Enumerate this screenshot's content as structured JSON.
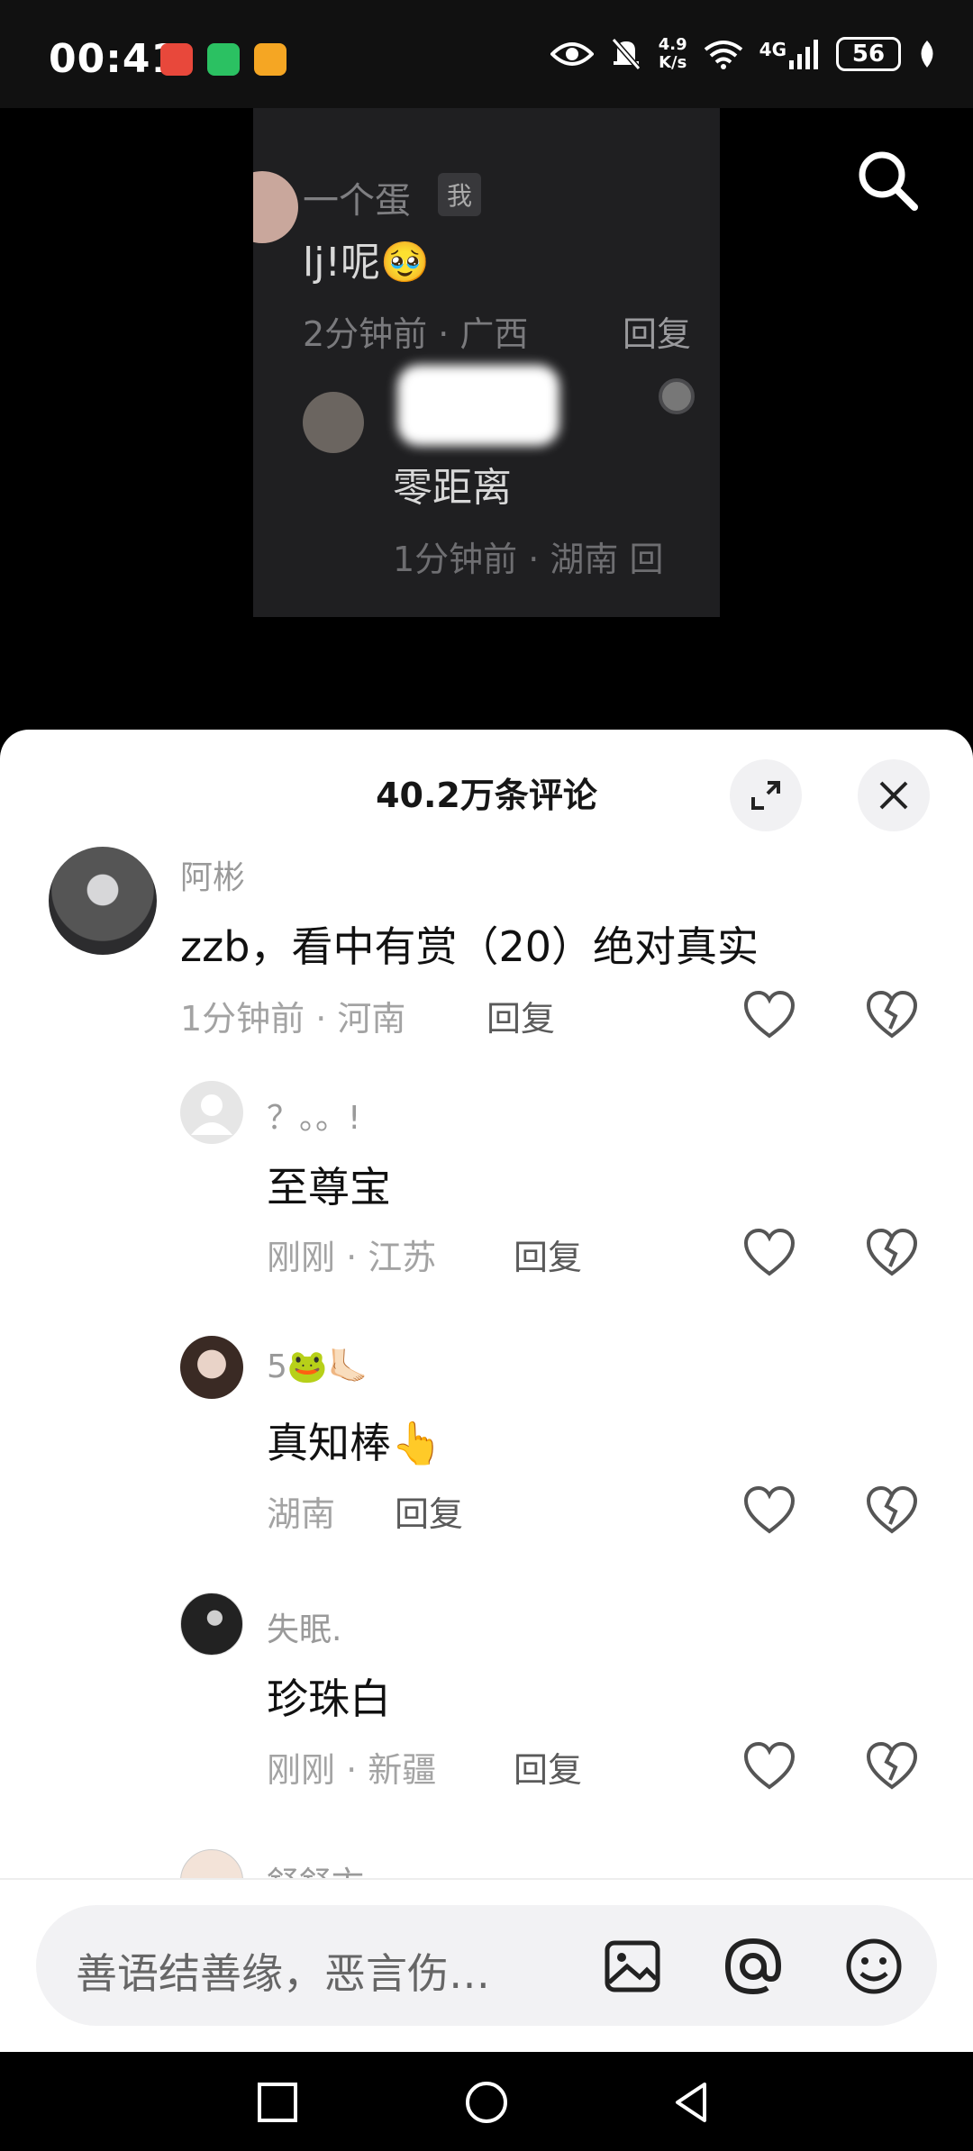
{
  "status_bar": {
    "time": "00:41",
    "net_speed_value": "4.9",
    "net_speed_unit": "K/s",
    "network": "4G",
    "battery": "56"
  },
  "video_overlay": {
    "user_name": "一个蛋",
    "user_tag": "我",
    "comment": "lj!呢🥹",
    "meta": "2分钟前 · 广西",
    "reply": "回复",
    "reply_comment": "零距离",
    "reply_meta": "1分钟前 · 湖南  回"
  },
  "sheet": {
    "title": "40.2万条评论"
  },
  "comments": [
    {
      "name": "阿彬",
      "text": "zzb，看中有赏（20）绝对真实",
      "meta": "1分钟前 · 河南",
      "reply": "回复"
    },
    {
      "name": "？。。!",
      "text": "至尊宝",
      "meta": "刚刚 · 江苏",
      "reply": "回复"
    },
    {
      "name": "5🐸🦶🏻",
      "text": "真知棒👆",
      "meta": "湖南",
      "reply": "回复"
    },
    {
      "name": "失眠.",
      "text": "珍珠白",
      "meta": "刚刚 · 新疆",
      "reply": "回复"
    },
    {
      "name": "舒舒卞"
    }
  ],
  "input": {
    "placeholder": "善语结善缘，恶言伤…"
  },
  "colors": {
    "sheet_bg": "#ffffff",
    "video_bg": "#000000",
    "text_primary": "#111111",
    "text_secondary": "#a3a3a3"
  }
}
